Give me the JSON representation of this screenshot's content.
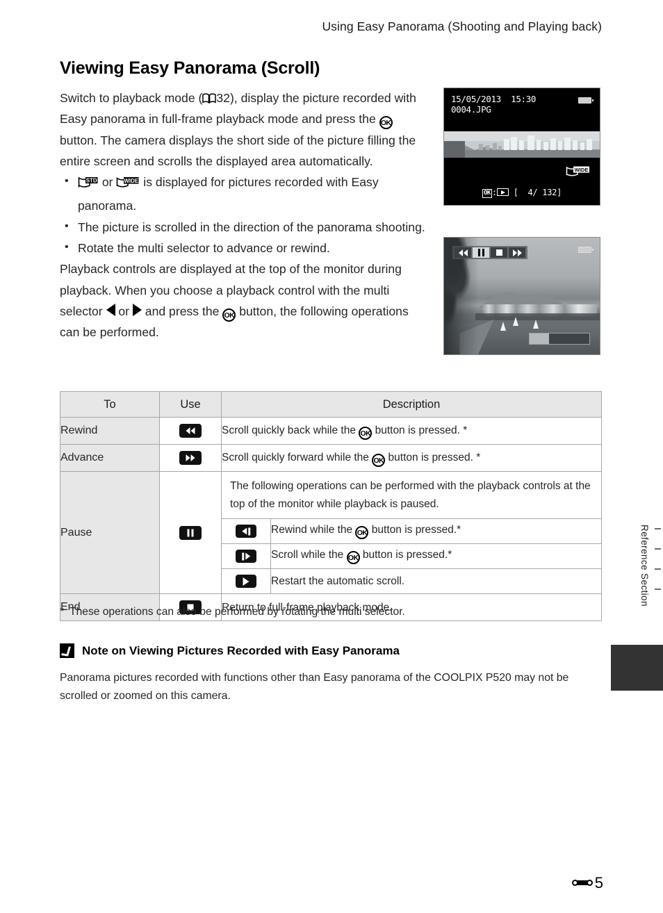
{
  "running_head": "Using Easy Panorama (Shooting and Playing back)",
  "page_title": "Viewing Easy Panorama (Scroll)",
  "body": {
    "intro_part1": "Switch to playback mode (",
    "intro_page_ref": "32",
    "intro_part2": "), display the picture recorded with Easy panorama in full-frame playback mode and press the ",
    "intro_part3": " button. The camera displays the short side of the picture filling the entire screen and scrolls the displayed area automatically.",
    "bullet1_mid": " or ",
    "bullet1_tail": " is displayed for pictures recorded with Easy panorama.",
    "bullet2": "The picture is scrolled in the direction of the panorama shooting.",
    "bullet3": "Rotate the multi selector to advance or rewind.",
    "outro_part1": "Playback controls are displayed at the top of the monitor during playback. When you choose a playback control with the multi selector ",
    "outro_or": " or ",
    "outro_part2": " and press the ",
    "outro_part3": " button, the following operations can be performed."
  },
  "screen_1": {
    "date": "15/05/2013  15:30",
    "filename": "0004.JPG",
    "badge": "WIDE",
    "ok_label": "OK",
    "separator": ":",
    "counter_open": "[",
    "counter": "4/ 132",
    "counter_close": "]"
  },
  "screen_2": {
    "controls": [
      "rewind",
      "pause",
      "stop",
      "fast-forward"
    ],
    "selected_control": "pause"
  },
  "table": {
    "headers": [
      "To",
      "Use",
      "Description"
    ],
    "rows": [
      {
        "to": "Rewind",
        "icon": "rewind-icon",
        "desc_part1": "Scroll quickly back while the ",
        "desc_part2": " button is pressed. *"
      },
      {
        "to": "Advance",
        "icon": "fast-forward-icon",
        "desc_part1": "Scroll quickly forward while the ",
        "desc_part2": " button is pressed. *"
      }
    ],
    "pause_row": {
      "to": "Pause",
      "icon": "pause-icon",
      "intro": "The following operations can be performed with the playback controls at the top of the monitor while playback is paused.",
      "sub_rows": [
        {
          "icon": "step-rewind-icon",
          "desc_part1": "Rewind while the ",
          "desc_part2": " button is pressed.*"
        },
        {
          "icon": "step-forward-icon",
          "desc_part1": "Scroll while the ",
          "desc_part2": " button is pressed.*"
        },
        {
          "icon": "play-icon",
          "desc_part1": "Restart the automatic scroll.",
          "desc_part2": ""
        }
      ]
    },
    "end_row": {
      "to": "End",
      "icon": "stop-icon",
      "desc": "Return to full-frame playback mode."
    }
  },
  "footnote": {
    "marker": "*",
    "text": "These operations can also be performed by rotating the multi selector."
  },
  "note": {
    "heading": "Note on Viewing Pictures Recorded with Easy Panorama",
    "body": "Panorama pictures recorded with functions other than Easy panorama of the COOLPIX P520 may not be scrolled or zoomed on this camera."
  },
  "side_tab": {
    "label": "Reference Section"
  },
  "footer": {
    "page_number": "5"
  },
  "colors": {
    "header_fill": "#e7e7e7",
    "border": "#a6a6a6",
    "tab_block": "#333333",
    "text": "#262626"
  }
}
